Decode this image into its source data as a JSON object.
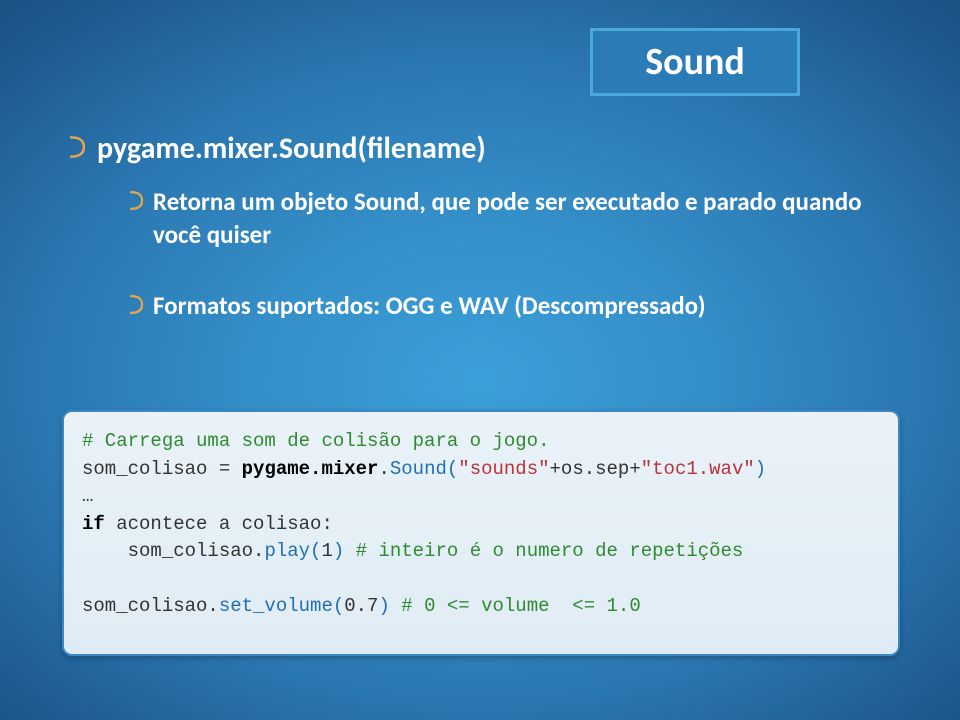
{
  "title": "Sound",
  "bullet1": "pygame.mixer.Sound(filename)",
  "sub1": "Retorna um objeto Sound, que pode ser executado e parado quando você quiser",
  "sub2": "Formatos suportados: OGG e WAV (Descompressado)",
  "code": {
    "c1": "# Carrega uma som de colisão para o jogo.",
    "l2a": "som_colisao = ",
    "l2b": "pygame.mixer",
    "l2c": ".",
    "l2d": "Sound(",
    "l2e": "\"sounds\"",
    "l2f": "+os.sep+",
    "l2g": "\"toc1.wav\"",
    "l2h": ")",
    "l3": "…",
    "l4a": "if",
    "l4b": " acontece a colisao:",
    "l5a": "    som_colisao.",
    "l5b": "play(",
    "l5c": "1",
    "l5d": ")",
    "l5e": " ",
    "l5f": "# inteiro é o numero de repetições",
    "l7a": "som_colisao.",
    "l7b": "set_volume(",
    "l7c": "0.7",
    "l7d": ")",
    "l7e": " ",
    "l7f": "# 0 <= volume  <= 1.0"
  }
}
